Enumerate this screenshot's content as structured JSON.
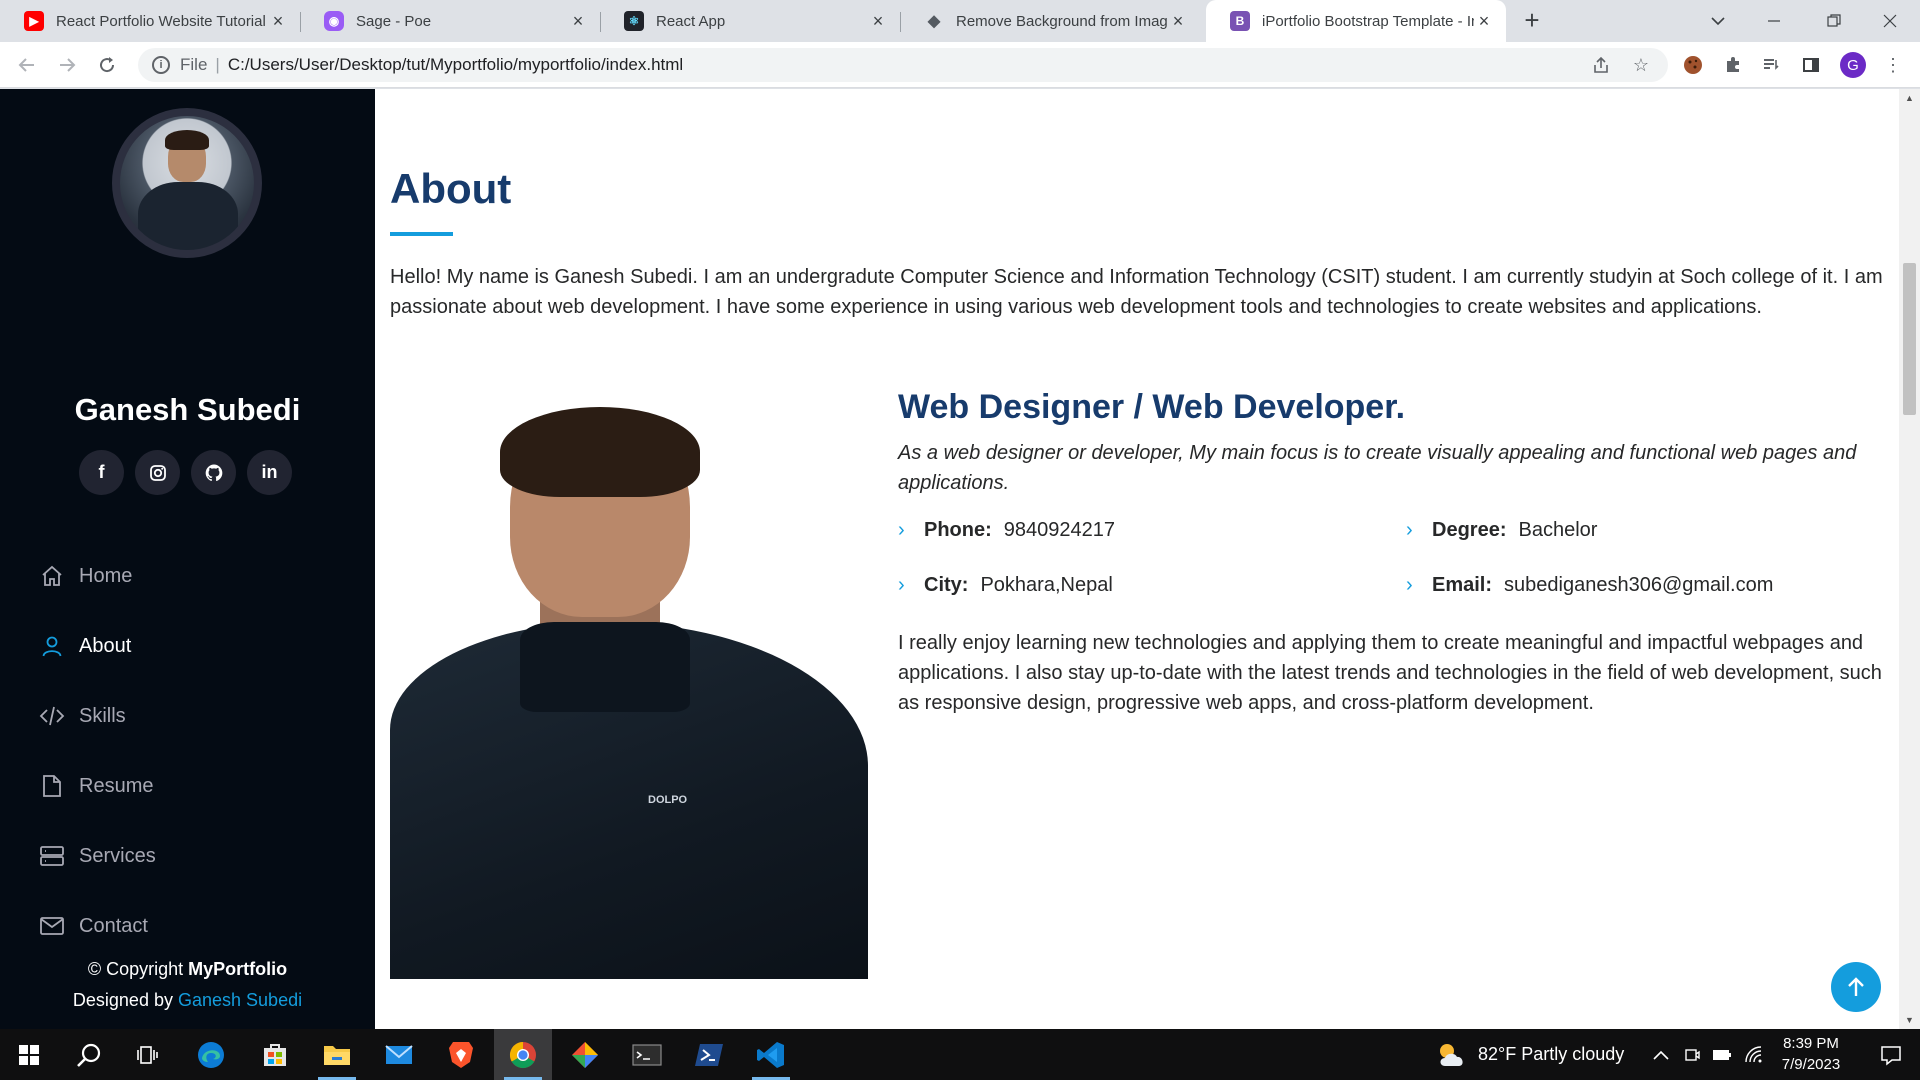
{
  "browser": {
    "tabs": [
      {
        "title": "React Portfolio Website Tutorial F",
        "favicon": "youtube-icon"
      },
      {
        "title": "Sage - Poe",
        "favicon": "poe-icon"
      },
      {
        "title": "React App",
        "favicon": "react-icon"
      },
      {
        "title": "Remove Background from Image",
        "favicon": "removebg-icon"
      },
      {
        "title": "iPortfolio Bootstrap Template - In",
        "favicon": "bootstrap-icon",
        "active": true
      }
    ],
    "address": {
      "scheme_label": "File",
      "url": "C:/Users/User/Desktop/tut/Myportfolio/myportfolio/index.html"
    },
    "profile_initial": "G"
  },
  "sidebar": {
    "name": "Ganesh Subedi",
    "socials": [
      {
        "icon": "facebook-icon",
        "glyph": "f"
      },
      {
        "icon": "instagram-icon",
        "glyph": ""
      },
      {
        "icon": "github-icon",
        "glyph": ""
      },
      {
        "icon": "linkedin-icon",
        "glyph": "in"
      }
    ],
    "nav": [
      {
        "label": "Home",
        "icon": "home-icon"
      },
      {
        "label": "About",
        "icon": "person-icon",
        "active": true
      },
      {
        "label": "Skills",
        "icon": "code-icon"
      },
      {
        "label": "Resume",
        "icon": "file-icon"
      },
      {
        "label": "Services",
        "icon": "server-icon"
      },
      {
        "label": "Contact",
        "icon": "envelope-icon"
      }
    ],
    "copyright_prefix": "© Copyright",
    "copyright_brand": "MyPortfolio",
    "designed_by_prefix": "Designed by",
    "designed_by_name": "Ganesh Subedi"
  },
  "about": {
    "title": "About",
    "intro": "Hello! My name is Ganesh Subedi. I am an undergradute Computer Science and Information Technology (CSIT) student. I am currently studyin at Soch college of it. I am passionate about web development. I have some experience in using various web development tools and technologies to create websites and applications.",
    "subtitle": "Web Designer / Web Developer.",
    "lead": "As a web designer or developer, My main focus is to create visually appealing and functional web pages and applications.",
    "facts": {
      "phone_label": "Phone:",
      "phone": "9840924217",
      "degree_label": "Degree:",
      "degree": "Bachelor",
      "city_label": "City:",
      "city": "Pokhara,Nepal",
      "email_label": "Email:",
      "email": "subediganesh306@gmail.com"
    },
    "body": "I really enjoy learning new technologies and applying them to create meaningful and impactful webpages and applications. I also stay up-to-date with the latest trends and technologies in the field of web development, such as responsive design, progressive web apps, and cross-platform development.",
    "photo_logo": "DOLPO"
  },
  "taskbar": {
    "weather": "82°F  Partly cloudy",
    "time": "8:39 PM",
    "date": "7/9/2023"
  },
  "colors": {
    "accent": "#149ddd",
    "heading": "#173b6c",
    "sidebar_bg": "#040b14"
  }
}
